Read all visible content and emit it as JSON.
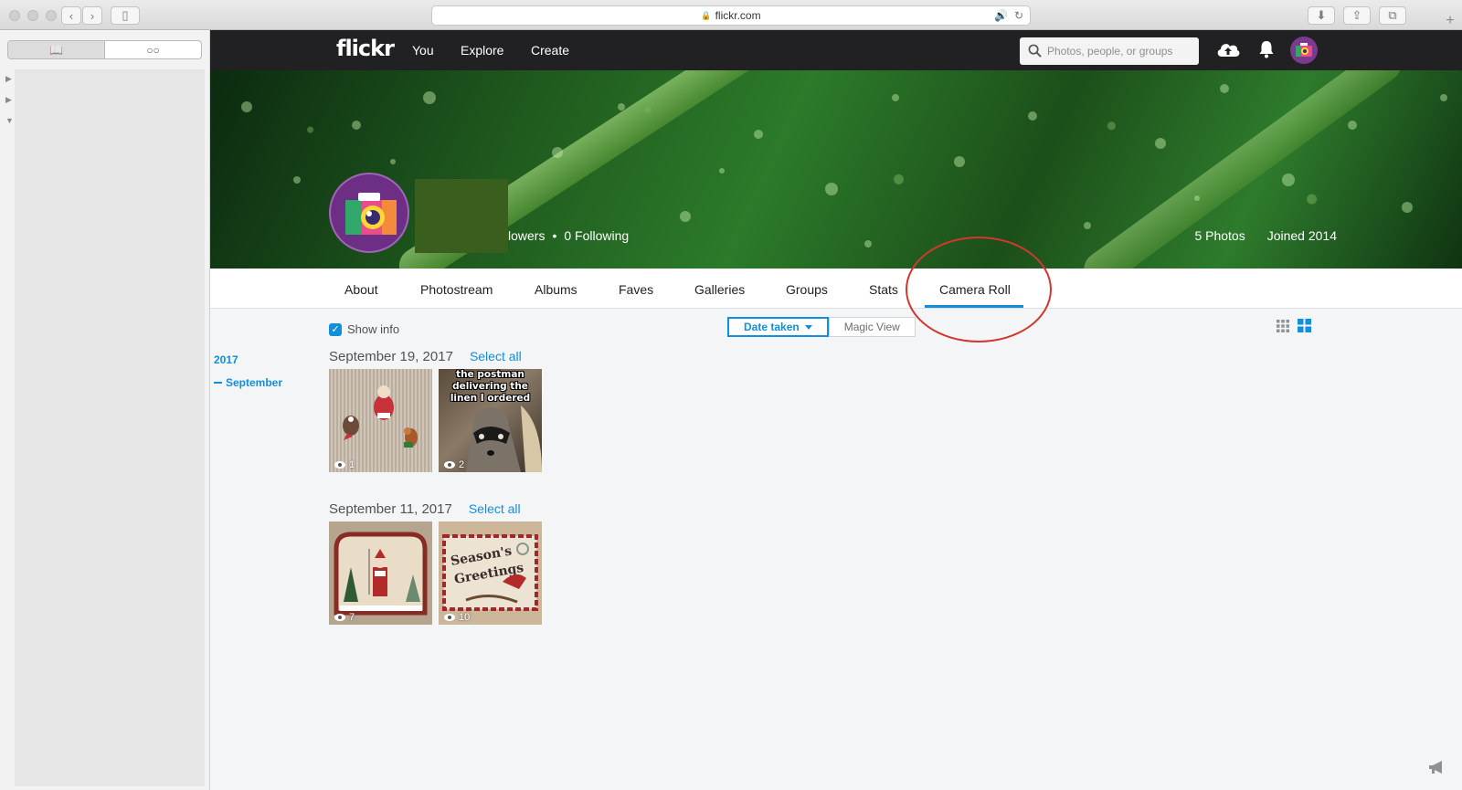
{
  "browser": {
    "url": "flickr.com",
    "reading_list_tabs": [
      "📖",
      "○○"
    ]
  },
  "nav": {
    "logo": "flickr",
    "links": [
      "You",
      "Explore",
      "Create"
    ],
    "search_placeholder": "Photos, people, or groups"
  },
  "profile": {
    "followers_text": "lowers",
    "bullet": "•",
    "following_text": "0 Following",
    "photos_count": "5 Photos",
    "joined": "Joined 2014"
  },
  "tabs": [
    "About",
    "Photostream",
    "Albums",
    "Faves",
    "Galleries",
    "Groups",
    "Stats",
    "Camera Roll"
  ],
  "active_tab": "Camera Roll",
  "toolbar": {
    "show_info": "Show info",
    "show_info_checked": true,
    "date_taken": "Date taken",
    "magic_view": "Magic View"
  },
  "timeline": {
    "year": "2017",
    "month": "September"
  },
  "groups": [
    {
      "date": "September 19, 2017",
      "select_all": "Select all",
      "photos": [
        {
          "views": "1"
        },
        {
          "views": "2",
          "caption": "the postman delivering the linen I ordered"
        }
      ]
    },
    {
      "date": "September 11, 2017",
      "select_all": "Select all",
      "photos": [
        {
          "views": "7"
        },
        {
          "views": "10",
          "caption": "Season's Greetings"
        }
      ]
    }
  ],
  "colors": {
    "accent": "#128fdc",
    "nav_bg": "#212124",
    "annotation": "#d1382f"
  }
}
